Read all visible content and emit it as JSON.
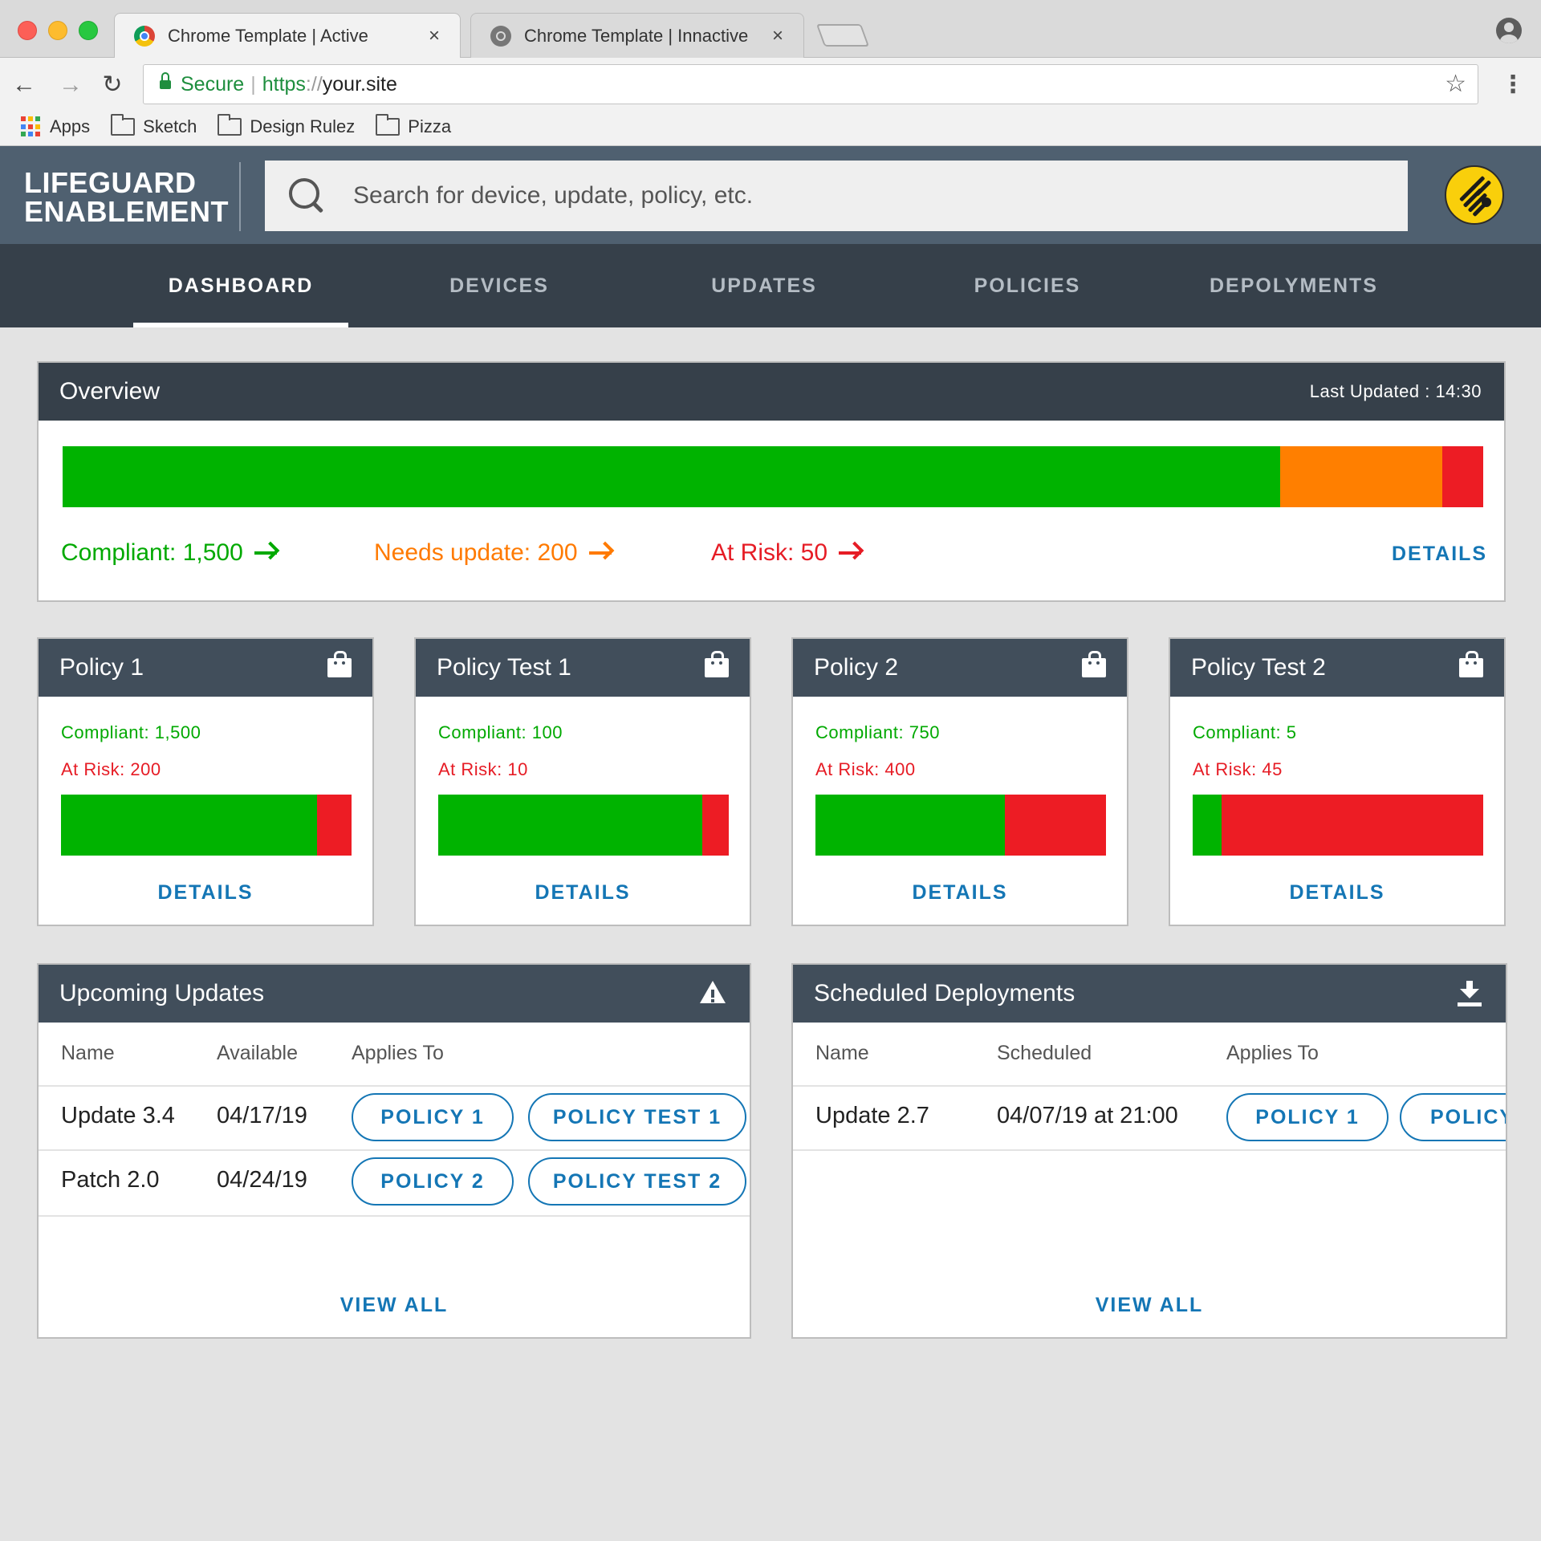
{
  "browser": {
    "tabs": [
      {
        "title": "Chrome Template | Active",
        "close": "×"
      },
      {
        "title": "Chrome Template | Innactive",
        "close": "×"
      }
    ],
    "secure_label": "Secure",
    "url_scheme": "https",
    "url_sep": "://",
    "url_host": "your.site",
    "bookmarks": [
      "Apps",
      "Sketch",
      "Design Rulez",
      "Pizza"
    ]
  },
  "header": {
    "logo_line1": "LIFEGUARD",
    "logo_line2": "ENABLEMENT",
    "search_placeholder": "Search for device, update, policy, etc."
  },
  "nav": {
    "tabs": [
      "DASHBOARD",
      "DEVICES",
      "UPDATES",
      "POLICIES",
      "DEPOLYMENTS"
    ],
    "active": "DASHBOARD"
  },
  "overview": {
    "title": "Overview",
    "last_updated": "Last Updated : 14:30",
    "compliant_label": "Compliant: 1,500",
    "needs_update_label": "Needs update: 200",
    "at_risk_label": "At Risk: 50",
    "details": "DETAILS",
    "bar": {
      "compliant": 1500,
      "needs_update": 200,
      "at_risk": 50
    }
  },
  "policies": [
    {
      "title": "Policy 1",
      "compliant_label": "Compliant: 1,500",
      "at_risk_label": "At Risk: 200",
      "compliant": 1500,
      "at_risk": 200,
      "details": "DETAILS"
    },
    {
      "title": "Policy Test 1",
      "compliant_label": "Compliant: 100",
      "at_risk_label": "At Risk: 10",
      "compliant": 100,
      "at_risk": 10,
      "details": "DETAILS"
    },
    {
      "title": "Policy 2",
      "compliant_label": "Compliant: 750",
      "at_risk_label": "At Risk: 400",
      "compliant": 750,
      "at_risk": 400,
      "details": "DETAILS"
    },
    {
      "title": "Policy Test 2",
      "compliant_label": "Compliant: 5",
      "at_risk_label": "At Risk: 45",
      "compliant": 5,
      "at_risk": 45,
      "details": "DETAILS"
    }
  ],
  "upcoming": {
    "title": "Upcoming Updates",
    "columns": [
      "Name",
      "Available",
      "Applies To"
    ],
    "rows": [
      {
        "name": "Update 3.4",
        "date": "04/17/19",
        "applies": [
          "POLICY 1",
          "POLICY TEST 1"
        ]
      },
      {
        "name": "Patch 2.0",
        "date": "04/24/19",
        "applies": [
          "POLICY 2",
          "POLICY TEST 2"
        ]
      }
    ],
    "view_all": "VIEW ALL"
  },
  "scheduled": {
    "title": "Scheduled Deployments",
    "columns": [
      "Name",
      "Scheduled",
      "Applies To"
    ],
    "rows": [
      {
        "name": "Update 2.7",
        "date": "04/07/19 at 21:00",
        "applies": [
          "POLICY 1",
          "POLICY"
        ]
      }
    ],
    "view_all": "VIEW ALL"
  },
  "colors": {
    "compliant": "#00b300",
    "needs_update": "#ff7f00",
    "at_risk": "#ed1c24",
    "header": "#4f6070",
    "nav": "#36404a",
    "link": "#1476b5",
    "avatar": "#f9cf0b"
  },
  "icons": {
    "search": "search-icon",
    "avatar": "zebra-logo-icon",
    "policy_card": "shopping-bag-icon",
    "upcoming": "warning-icon",
    "scheduled": "download-icon",
    "arrow": "arrow-right-icon"
  }
}
